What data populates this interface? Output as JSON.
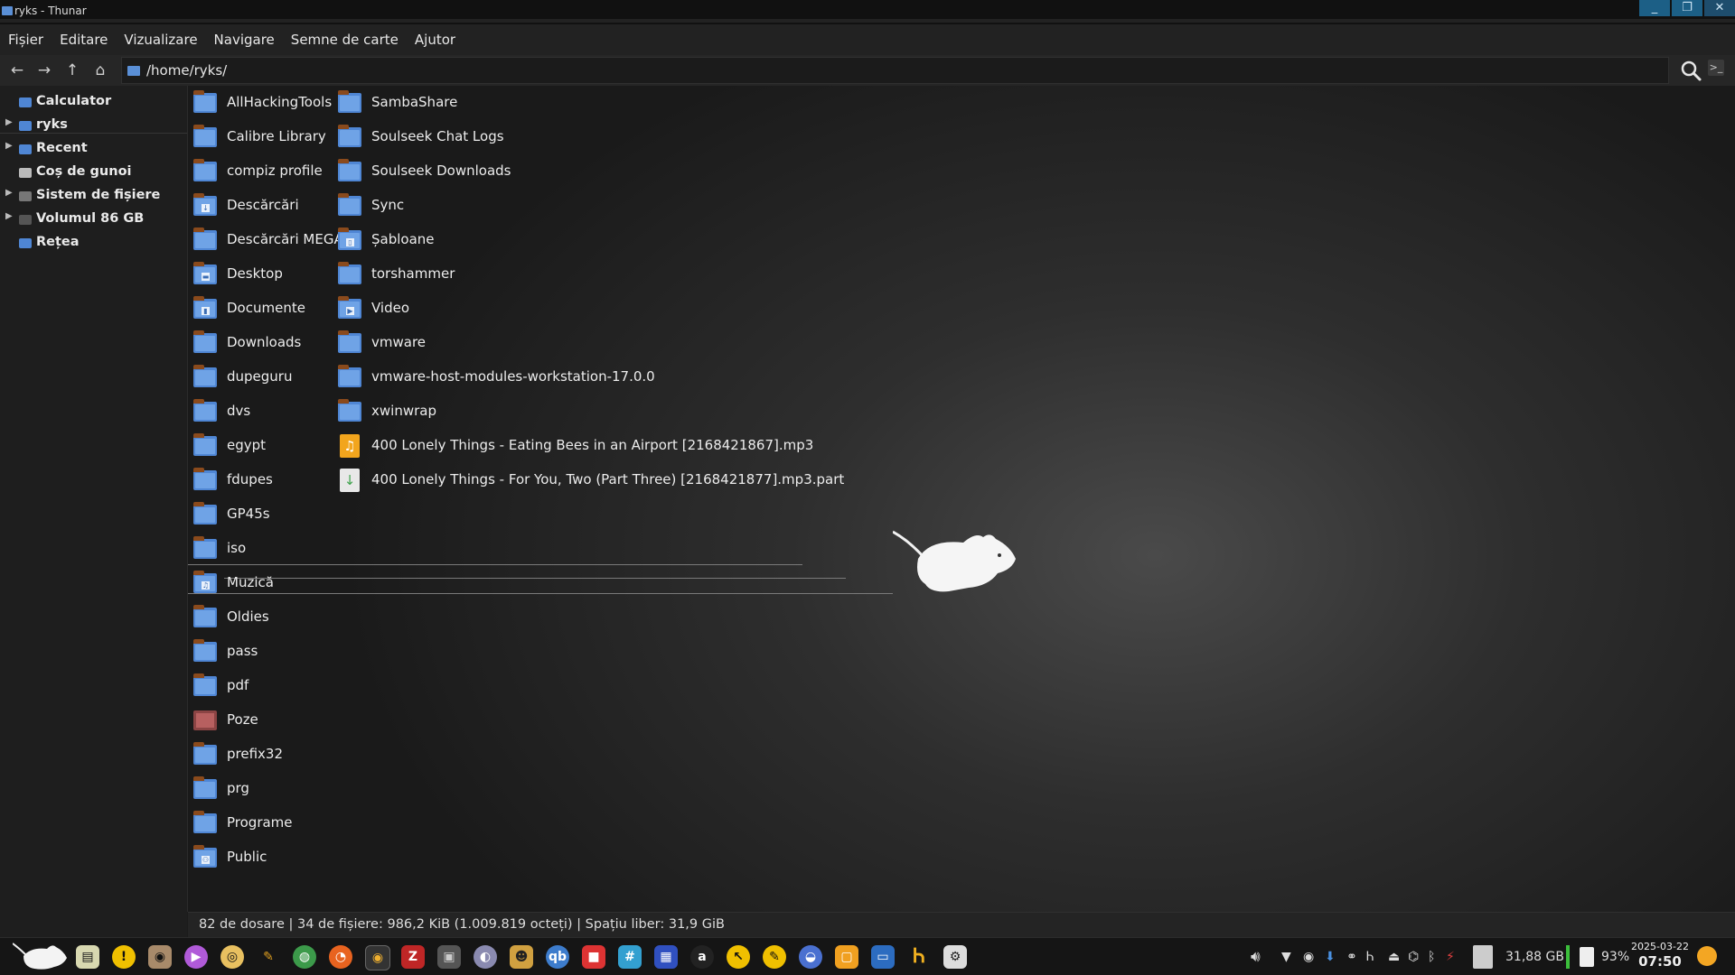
{
  "window": {
    "title": "ryks - Thunar"
  },
  "menu": [
    "Fișier",
    "Editare",
    "Vizualizare",
    "Navigare",
    "Semne de carte",
    "Ajutor"
  ],
  "toolbar": {
    "path": "/home/ryks/"
  },
  "sidebar": {
    "items": [
      {
        "label": "Calculator",
        "expandable": false,
        "icon": "computer-icon"
      },
      {
        "label": "ryks",
        "expandable": true,
        "icon": "home-folder-icon"
      },
      {
        "label": "Recent",
        "expandable": true,
        "icon": "recent-icon"
      },
      {
        "label": "Coș de gunoi",
        "expandable": false,
        "icon": "trash-icon"
      },
      {
        "label": "Sistem de fișiere",
        "expandable": true,
        "icon": "filesystem-icon"
      },
      {
        "label": "Volumul 86 GB",
        "expandable": true,
        "icon": "drive-icon"
      },
      {
        "label": "Rețea",
        "expandable": false,
        "icon": "network-icon"
      }
    ]
  },
  "files": {
    "column1": [
      {
        "name": "AllHackingTools",
        "type": "folder"
      },
      {
        "name": "Calibre Library",
        "type": "folder"
      },
      {
        "name": "compiz profile",
        "type": "folder"
      },
      {
        "name": "Descărcări",
        "type": "folder",
        "emblem": "↓"
      },
      {
        "name": "Descărcări MEGA",
        "type": "folder"
      },
      {
        "name": "Desktop",
        "type": "folder",
        "emblem": "▬"
      },
      {
        "name": "Documente",
        "type": "folder",
        "emblem": "▮"
      },
      {
        "name": "Downloads",
        "type": "folder"
      },
      {
        "name": "dupeguru",
        "type": "folder"
      },
      {
        "name": "dvs",
        "type": "folder"
      },
      {
        "name": "egypt",
        "type": "folder"
      },
      {
        "name": "fdupes",
        "type": "folder"
      },
      {
        "name": "GP45s",
        "type": "folder"
      },
      {
        "name": "iso",
        "type": "folder"
      },
      {
        "name": "Muzică",
        "type": "folder",
        "emblem": "♫"
      },
      {
        "name": "Oldies",
        "type": "folder"
      },
      {
        "name": "pass",
        "type": "folder"
      },
      {
        "name": "pdf",
        "type": "folder"
      },
      {
        "name": "Poze",
        "type": "photo"
      },
      {
        "name": "prefix32",
        "type": "folder"
      },
      {
        "name": "prg",
        "type": "folder"
      },
      {
        "name": "Programe",
        "type": "folder"
      },
      {
        "name": "Public",
        "type": "folder",
        "emblem": "⚇"
      }
    ],
    "column2": [
      {
        "name": "SambaShare",
        "type": "folder"
      },
      {
        "name": "Soulseek Chat Logs",
        "type": "folder"
      },
      {
        "name": "Soulseek Downloads",
        "type": "folder"
      },
      {
        "name": "Sync",
        "type": "folder"
      },
      {
        "name": "Șabloane",
        "type": "folder",
        "emblem": "▯"
      },
      {
        "name": "torshammer",
        "type": "folder"
      },
      {
        "name": "Video",
        "type": "folder",
        "emblem": "▶"
      },
      {
        "name": "vmware",
        "type": "folder"
      },
      {
        "name": "vmware-host-modules-workstation-17.0.0",
        "type": "folder"
      },
      {
        "name": "xwinwrap",
        "type": "folder"
      },
      {
        "name": "400 Lonely Things - Eating Bees in an Airport [2168421867].mp3",
        "type": "mp3"
      },
      {
        "name": "400 Lonely Things - For You, Two (Part Three) [2168421877].mp3.part",
        "type": "part"
      }
    ]
  },
  "status": {
    "text": "82 de dosare  |  34 de fișiere: 986,2 KiB (1.009.819 octeți)  |  Spațiu liber: 31,9 GiB"
  },
  "tray": {
    "storage": "31,88 GB",
    "battery": "93%",
    "date": "2025-03-22",
    "time": "07:50"
  },
  "colors": {
    "folder": "#4f86d4",
    "folder_tab": "#8a4a1c",
    "accent": "#1c5f86"
  }
}
